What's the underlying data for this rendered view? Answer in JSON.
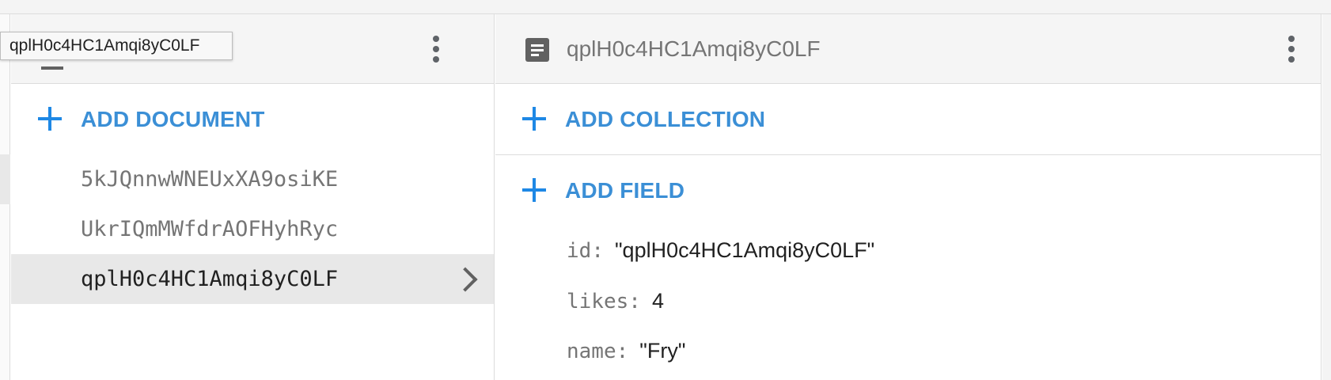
{
  "tooltip": {
    "text": "qplH0c4HC1Amqi8yC0LF"
  },
  "left_panel": {
    "add_label": "ADD DOCUMENT",
    "documents": [
      {
        "id": "5kJQnnwWNEUxXA9osiKE",
        "selected": false
      },
      {
        "id": "UkrIQmMWfdrAOFHyhRyc",
        "selected": false
      },
      {
        "id": "qplH0c4HC1Amqi8yC0LF",
        "selected": true
      }
    ]
  },
  "right_panel": {
    "title": "qplH0c4HC1Amqi8yC0LF",
    "add_collection_label": "ADD COLLECTION",
    "add_field_label": "ADD FIELD",
    "fields": [
      {
        "key": "id",
        "value": "\"qplH0c4HC1Amqi8yC0LF\""
      },
      {
        "key": "likes",
        "value": "4"
      },
      {
        "key": "name",
        "value": "\"Fry\""
      }
    ]
  },
  "colors": {
    "accent": "#3b8fd6",
    "selected_row": "#e8e8e8",
    "icon": "#616161"
  },
  "icons": [
    "document-icon",
    "more-vert-icon",
    "plus-icon",
    "chevron-right-icon"
  ]
}
